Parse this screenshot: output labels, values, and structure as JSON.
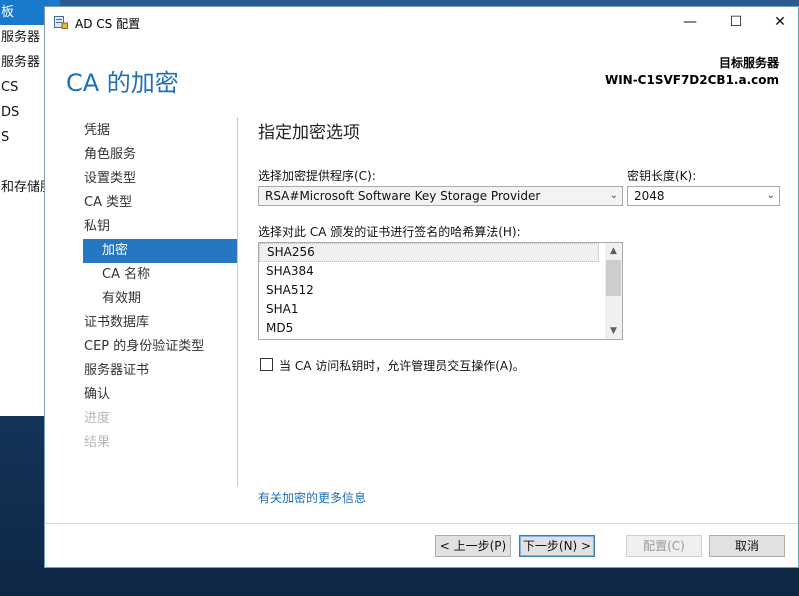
{
  "background_window": {
    "items": [
      "板",
      "服务器",
      "服务器",
      "CS",
      "DS",
      "S",
      "",
      "和存储服"
    ]
  },
  "dialog": {
    "title": "AD CS 配置",
    "window_controls": {
      "minimize": "—",
      "maximize": "☐",
      "close": "✕"
    },
    "header_title": "CA 的加密",
    "target_label": "目标服务器",
    "target_value": "WIN-C1SVF7D2CB1.a.com"
  },
  "nav": {
    "items": [
      {
        "label": "凭据"
      },
      {
        "label": "角色服务"
      },
      {
        "label": "设置类型"
      },
      {
        "label": "CA 类型"
      },
      {
        "label": "私钥"
      },
      {
        "label": "加密"
      },
      {
        "label": "CA 名称"
      },
      {
        "label": "有效期"
      },
      {
        "label": "证书数据库"
      },
      {
        "label": "CEP 的身份验证类型"
      },
      {
        "label": "服务器证书"
      },
      {
        "label": "确认"
      },
      {
        "label": "进度"
      },
      {
        "label": "结果"
      }
    ]
  },
  "content": {
    "section_title": "指定加密选项",
    "provider_label": "选择加密提供程序(C):",
    "provider_value": "RSA#Microsoft Software Key Storage Provider",
    "keylength_label": "密钥长度(K):",
    "keylength_value": "2048",
    "hash_label": "选择对此 CA 颁发的证书进行签名的哈希算法(H):",
    "hash_options": [
      "SHA256",
      "SHA384",
      "SHA512",
      "SHA1",
      "MD5"
    ],
    "hash_selected": "SHA256",
    "checkbox_label": "当 CA 访问私钥时，允许管理员交互操作(A)。",
    "checkbox_checked": false,
    "more_info_link": "有关加密的更多信息"
  },
  "footer": {
    "prev_label": "< 上一步(P)",
    "next_label": "下一步(N) >",
    "configure_label": "配置(C)",
    "cancel_label": "取消"
  },
  "colors": {
    "accent": "#2577c3",
    "header_blue": "#1e6fb8"
  }
}
